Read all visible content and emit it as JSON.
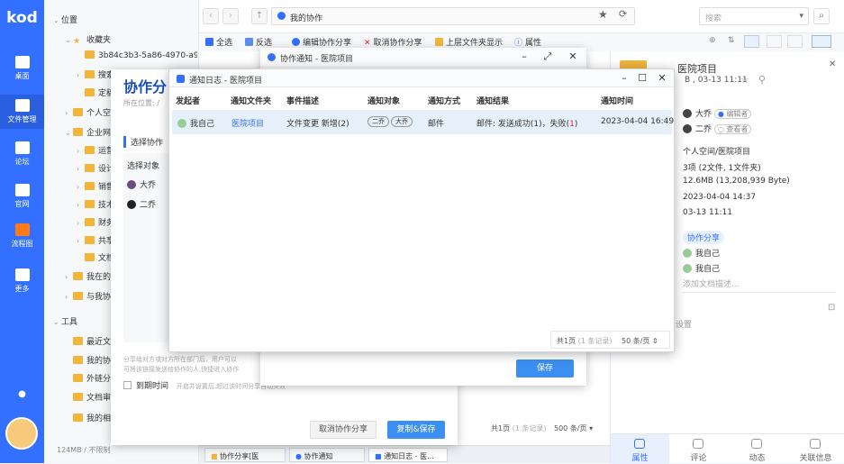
{
  "rail": {
    "logo": "kod",
    "items": [
      {
        "label": "桌面",
        "icon": "desktop-icon"
      },
      {
        "label": "文件管理",
        "icon": "folder-icon"
      },
      {
        "label": "论坛",
        "icon": "chat-icon"
      },
      {
        "label": "官网",
        "icon": "home-icon"
      },
      {
        "label": "流程图",
        "icon": "flowchart-icon"
      },
      {
        "label": "更多",
        "icon": "grid-icon"
      }
    ]
  },
  "tree": {
    "items": [
      {
        "label": "位置",
        "level": 0,
        "arrow": "⌄"
      },
      {
        "label": "收藏夹",
        "level": 1,
        "arrow": "⌄",
        "star": true
      },
      {
        "label": "3b84c3b3-5a86-4970-a9...",
        "level": 2
      },
      {
        "label": "搜索",
        "level": 2,
        "arrow": "›"
      },
      {
        "label": "定稿",
        "level": 2
      },
      {
        "label": "个人空",
        "level": 1,
        "arrow": "›"
      },
      {
        "label": "企业网",
        "level": 1,
        "arrow": "⌄"
      },
      {
        "label": "运营",
        "level": 2,
        "arrow": "›"
      },
      {
        "label": "设计",
        "level": 2,
        "arrow": "›"
      },
      {
        "label": "销售",
        "level": 2,
        "arrow": "›"
      },
      {
        "label": "技术",
        "level": 2,
        "arrow": "›"
      },
      {
        "label": "财务",
        "level": 2,
        "arrow": "›"
      },
      {
        "label": "共享",
        "level": 2,
        "arrow": "›"
      },
      {
        "label": "文档",
        "level": 2
      },
      {
        "label": "我在的",
        "level": 1,
        "arrow": "›"
      },
      {
        "label": "与我协",
        "level": 1,
        "arrow": "›"
      },
      {
        "label": "工具",
        "level": 0,
        "arrow": "⌄"
      },
      {
        "label": "最近文",
        "level": 1
      },
      {
        "label": "我的协",
        "level": 1
      },
      {
        "label": "外链分",
        "level": 1
      },
      {
        "label": "文档审",
        "level": 1
      },
      {
        "label": "我的相",
        "level": 1
      }
    ],
    "footer": "124MB / 不限制"
  },
  "topbar": {
    "breadcrumb": "我的协作",
    "search_placeholder": "搜索"
  },
  "toolbar": {
    "select_all": "全选",
    "invert": "反选",
    "edit_share": "编辑协作分享",
    "cancel_share": "取消协作分享",
    "parent_folder": "上层文件夹显示",
    "properties": "属性"
  },
  "props": {
    "title": "医院项目",
    "subtitle": "B , 03-13 11:11",
    "users": [
      {
        "name": "大乔",
        "role": "编辑者"
      },
      {
        "name": "二乔",
        "role": "查看者"
      }
    ],
    "path": "个人空间/医院项目",
    "count": "3项 (2文件, 1文件夹)",
    "size": "12.6MB (13,208,939 Byte)",
    "created": "2023-04-04 14:37",
    "modified": "03-13 11:11",
    "share_badge": "协作分享",
    "owner1": "我自己",
    "owner2": "我自己",
    "desc_placeholder": "添加文档描述...",
    "setting": "设置",
    "tabs": [
      "属性",
      "评论",
      "动态",
      "关联信息"
    ]
  },
  "share": {
    "title": "协作分",
    "location": "所在位置: /",
    "section": "选择协作",
    "col": "选择对象",
    "users": [
      "大乔",
      "二乔"
    ],
    "hint1": "分享给对方或对方所在部门后，用户可以",
    "hint2": "可将该链接发送给协作的人,快捷进入协作",
    "expire": "到期时间",
    "expire_hint": "开启并设置后,超过该时间分享自动失效",
    "cancel": "取消协作分享",
    "save": "复制&保存"
  },
  "notif": {
    "title": "协作通知 - 医院项目",
    "save": "保存"
  },
  "log": {
    "title": "通知日志 - 医院项目",
    "headers": [
      "发起者",
      "通知文件夹",
      "事件描述",
      "通知对象",
      "通知方式",
      "通知结果",
      "通知时间"
    ],
    "row": {
      "initiator": "我自己",
      "folder": "医院项目",
      "event": "文件变更 新增(2)",
      "targets": [
        "二乔",
        "大乔"
      ],
      "method": "邮件",
      "result_prefix": "邮件: 发送成功(1)，失败(",
      "result_fail": "1",
      "result_suffix": ")",
      "time": "2023-04-04 16:49"
    },
    "pager": "共1页",
    "pager_note": "(1 条记录)",
    "per_page": "50 条/页"
  },
  "main_pager": {
    "pages": "共1页",
    "note": "(1 条记录)",
    "per_page": "500 条/页"
  },
  "taskbar": [
    "协作分享[医",
    "协作通知",
    "通知日志 - 医..."
  ]
}
